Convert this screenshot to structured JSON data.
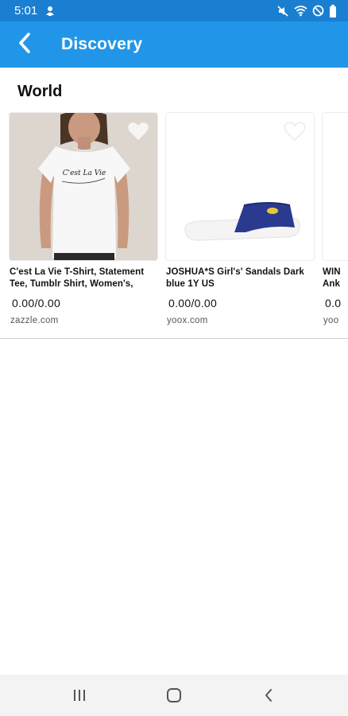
{
  "status_bar": {
    "time": "5:01",
    "left_icons": [
      "notification-icon"
    ],
    "right_icons": [
      "mute-icon",
      "wifi-icon",
      "dnd-icon",
      "battery-icon"
    ]
  },
  "app_bar": {
    "title": "Discovery",
    "back_icon": "back-arrow-icon"
  },
  "section": {
    "title": "World",
    "products": [
      {
        "name": "C'est La Vie T-Shirt, Statement Tee, Tumblr Shirt, Women's,",
        "price": "0.00/0.00",
        "source": "zazzle.com",
        "shirt_text": "C'est La Vie"
      },
      {
        "name": "JOSHUA*S Girl's' Sandals Dark blue 1Y US",
        "price": "0.00/0.00",
        "source": "yoox.com"
      },
      {
        "name": "WIN Ank",
        "price": "0.0",
        "source": "yoo"
      }
    ]
  },
  "colors": {
    "status_bar": "#1a7fd1",
    "app_bar": "#2196e8",
    "nav_bar": "#f3f3f3"
  },
  "nav_bar": {
    "buttons": [
      "recent-apps-icon",
      "home-icon",
      "back-icon"
    ]
  }
}
